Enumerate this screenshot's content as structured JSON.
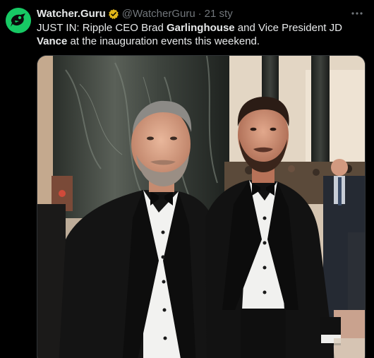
{
  "tweet": {
    "display_name": "Watcher.Guru",
    "handle": "@WatcherGuru",
    "separator": "·",
    "time": "21 sty",
    "text": {
      "part1": "JUST IN: Ripple CEO Brad ",
      "bold1": "Garlinghouse",
      "part2": " and Vice President JD ",
      "bold2": "Vance",
      "part3": " at the inauguration events this weekend."
    }
  },
  "icons": {
    "avatar": "watcher-guru-logo",
    "verified": "verified-badge-icon",
    "more": "more-options-icon"
  },
  "colors": {
    "background": "#000000",
    "text": "#e7e9ea",
    "secondary_text": "#71767b",
    "verified_badge": "#e2b719",
    "avatar_bg": "#17c964"
  }
}
